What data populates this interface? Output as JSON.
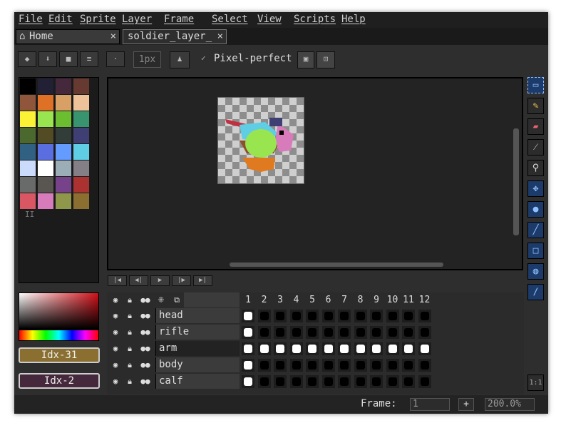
{
  "menu": [
    "File",
    "Edit",
    "Sprite",
    "Layer",
    "Frame",
    "Select",
    "View",
    "Scripts",
    "Help"
  ],
  "tabs": [
    {
      "label": "Home",
      "close": "×",
      "icon": "home-icon"
    },
    {
      "label": "soldier_layer_",
      "close": "×"
    }
  ],
  "toolbar": {
    "brush_size": "1px",
    "pixel_perfect_label": "Pixel-perfect",
    "pixel_perfect_checked": true
  },
  "palette": {
    "colors": [
      "#000000",
      "#222034",
      "#45283c",
      "#663931",
      "#8f563b",
      "#df7126",
      "#d9a066",
      "#eec39a",
      "#fbf236",
      "#99e550",
      "#6abe30",
      "#37946e",
      "#4b692f",
      "#524b24",
      "#323c39",
      "#3f3f74",
      "#306082",
      "#5b6ee1",
      "#639bff",
      "#5fcde4",
      "#cbdbfc",
      "#ffffff",
      "#9badb7",
      "#847e87",
      "#696a6a",
      "#595652",
      "#76428a",
      "#ac3232",
      "#d95763",
      "#d77bba",
      "#8f974a",
      "#8a6f30"
    ],
    "marker": "II"
  },
  "colors": {
    "fg_label": "Idx-31",
    "fg_color": "#8a6f30",
    "bg_label": "Idx-2",
    "bg_color": "#45283c",
    "selected_tool": "#1c3b6a",
    "accent": "#4a90e2"
  },
  "timeline": {
    "frames": [
      "1",
      "2",
      "3",
      "4",
      "5",
      "6",
      "7",
      "8",
      "9",
      "10",
      "11",
      "12"
    ],
    "layers": [
      {
        "name": "head",
        "cels": [
          1,
          0,
          0,
          0,
          0,
          0,
          0,
          0,
          0,
          0,
          0,
          0
        ],
        "active": false
      },
      {
        "name": "rifle",
        "cels": [
          1,
          0,
          0,
          0,
          0,
          0,
          0,
          0,
          0,
          0,
          0,
          0
        ],
        "active": false
      },
      {
        "name": "arm",
        "cels": [
          1,
          1,
          1,
          1,
          1,
          1,
          1,
          1,
          1,
          1,
          1,
          1
        ],
        "active": true
      },
      {
        "name": "body",
        "cels": [
          1,
          0,
          0,
          0,
          0,
          0,
          0,
          0,
          0,
          0,
          0,
          0
        ],
        "active": false
      },
      {
        "name": "calf",
        "cels": [
          1,
          0,
          0,
          0,
          0,
          0,
          0,
          0,
          0,
          0,
          0,
          0
        ],
        "active": false
      }
    ]
  },
  "status": {
    "frame_label": "Frame:",
    "frame_value": "1",
    "zoom": "200.0%",
    "add_symbol": "+"
  },
  "tools": [
    "rectangular-marquee",
    "pencil",
    "eraser",
    "eyedropper",
    "zoom",
    "move",
    "paint-bucket",
    "line",
    "rectangle",
    "ellipse",
    "contour"
  ]
}
